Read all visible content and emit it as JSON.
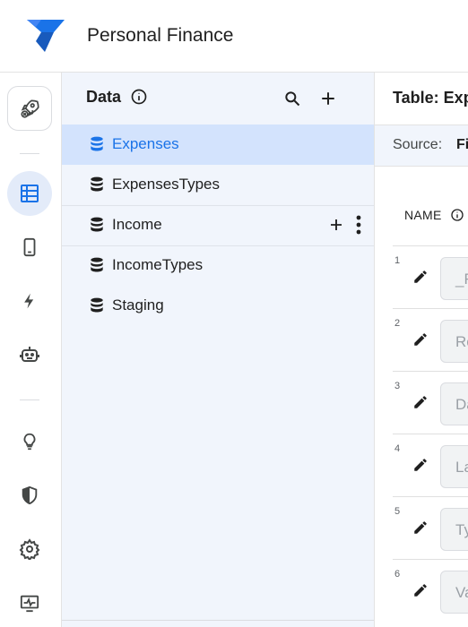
{
  "app": {
    "title": "Personal Finance"
  },
  "rail": {
    "icons": [
      "rocket-icon",
      "table-icon",
      "phone-icon",
      "bolt-icon",
      "robot-icon",
      "lightbulb-icon",
      "shield-icon",
      "gear-icon",
      "monitor-icon"
    ]
  },
  "data_panel": {
    "title": "Data",
    "tables": [
      {
        "label": "Expenses",
        "selected": true
      },
      {
        "label": "ExpensesTypes",
        "selected": false
      },
      {
        "label": "Income",
        "selected": false
      },
      {
        "label": "IncomeTypes",
        "selected": false
      },
      {
        "label": "Staging",
        "selected": false
      }
    ]
  },
  "main": {
    "title": "Table: Exp",
    "source_label": "Source:",
    "source_value": "Fi",
    "column_header": "NAME",
    "rows": [
      {
        "num": "1",
        "value": "_R"
      },
      {
        "num": "2",
        "value": "Ro"
      },
      {
        "num": "3",
        "value": "Da"
      },
      {
        "num": "4",
        "value": "La"
      },
      {
        "num": "5",
        "value": "Ty"
      },
      {
        "num": "6",
        "value": "Va"
      }
    ]
  },
  "colors": {
    "accent": "#1a73e8",
    "selected_bg": "#d3e3fd",
    "panel_bg": "#f1f5fc"
  }
}
